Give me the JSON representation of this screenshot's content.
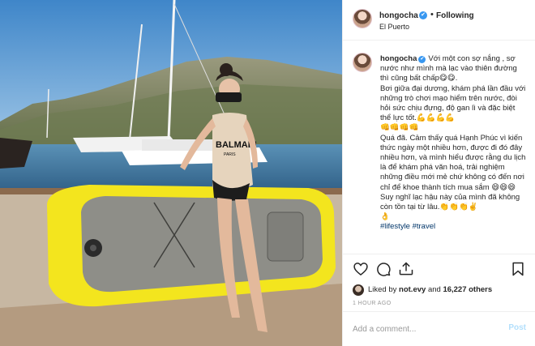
{
  "header": {
    "username": "hongocha",
    "verified_mark": "✔",
    "separator": "•",
    "follow_state": "Following",
    "location": "El Puerto"
  },
  "photo": {
    "board_brand": "BALMAIN",
    "board_brand_sub": "PARIS",
    "icon": "photo-post-image"
  },
  "caption": {
    "username": "hongocha",
    "verified_mark": "✔",
    "body": "Với một con sợ nắng , sợ nước như mình mà lạc vào thiên đường thì cũng bất chấp😋😋.\nBơi giữa đại dương, khám phá lần đầu với những trò chơi mạo hiểm trên nước, đòi hỏi sức chịu đựng, độ gan lì và đặc biệt thể lực tốt.💪💪💪💪\n👊👊👊👊\nQuá đã. Cảm thấy quá Hạnh Phúc vì kiến thức ngày một nhiều hơn, được đi đó đây nhiều hơn, và mình hiểu được rằng du lịch là để khám phá văn hoá, trải nghiệm những điều mới mẻ chứ không có đến nơi chỉ để khoe thành tích mua sắm 😄😄😄\nSuy nghĩ lạc hậu này của mình đã không còn tồn tại từ lâu.👏👏👏✌️\n👌",
    "hashtags": "#lifestyle #travel"
  },
  "actions": {
    "like_icon": "heart-icon",
    "comment_icon": "comment-icon",
    "share_icon": "share-icon",
    "save_icon": "bookmark-icon"
  },
  "likes": {
    "prefix": "Liked by",
    "user": "not.evy",
    "connector": "and",
    "count_text": "16,227 others"
  },
  "time_ago": "1 HOUR AGO",
  "comment": {
    "placeholder": "Add a comment...",
    "post_label": "Post"
  },
  "colors": {
    "accent": "#3897f0",
    "post_disabled": "#b2dffc",
    "hashtag": "#003569",
    "border": "#efefef"
  }
}
